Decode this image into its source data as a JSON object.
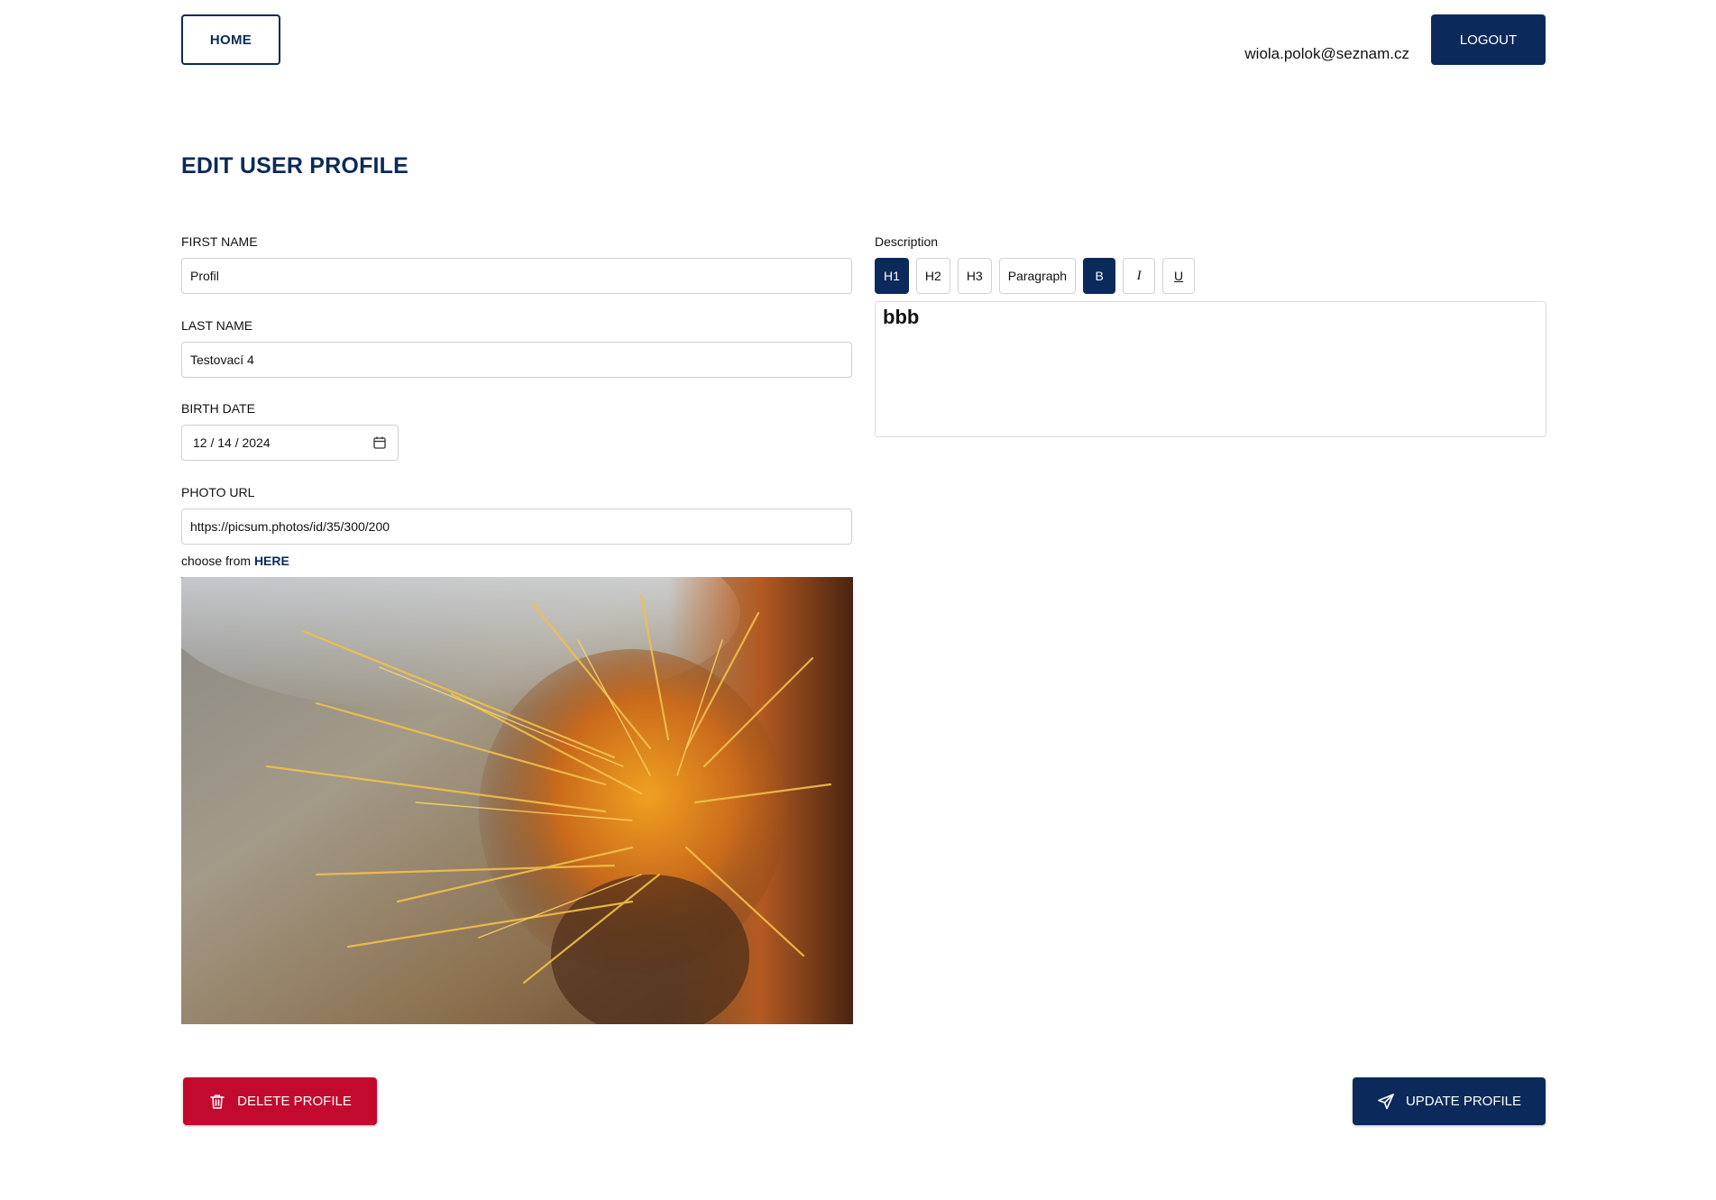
{
  "header": {
    "home_label": "HOME",
    "user_email": "wiola.polok@seznam.cz",
    "logout_label": "LOGOUT"
  },
  "page_title": "EDIT USER PROFILE",
  "form": {
    "first_name": {
      "label": "FIRST NAME",
      "value": "Profil"
    },
    "last_name": {
      "label": "LAST NAME",
      "value": "Testovací 4"
    },
    "birth_date": {
      "label": "BIRTH DATE",
      "value": "12 / 14 / 2024",
      "icon": "calendar-icon"
    },
    "photo_url": {
      "label": "PHOTO URL",
      "value": "https://picsum.photos/id/35/300/200",
      "choose_prefix": "choose from ",
      "choose_link": "HERE"
    }
  },
  "description": {
    "label": "Description",
    "toolbar": [
      {
        "label": "H1",
        "active": true
      },
      {
        "label": "H2",
        "active": false
      },
      {
        "label": "H3",
        "active": false
      },
      {
        "label": "Paragraph",
        "active": false
      },
      {
        "label": "B",
        "active": true
      },
      {
        "label": "I",
        "active": false
      },
      {
        "label": "U",
        "active": false
      }
    ],
    "content": "bbb"
  },
  "actions": {
    "delete_label": "DELETE PROFILE",
    "delete_icon": "trash-icon",
    "update_label": "UPDATE PROFILE",
    "update_icon": "send-icon"
  },
  "colors": {
    "primary": "#0b2a5b",
    "danger": "#c3092d",
    "border": "#cfcfcf"
  }
}
